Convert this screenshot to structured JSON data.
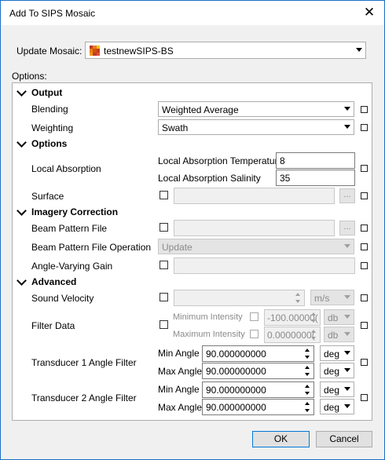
{
  "window": {
    "title": "Add To SIPS Mosaic",
    "close_glyph": "✕"
  },
  "update_mosaic": {
    "label": "Update Mosaic:",
    "value": "testnewSIPS-BS",
    "icon": "mosaic-icon"
  },
  "options_label": "Options:",
  "output": {
    "header": "Output",
    "blending": {
      "label": "Blending",
      "value": "Weighted Average"
    },
    "weighting": {
      "label": "Weighting",
      "value": "Swath"
    }
  },
  "options": {
    "header": "Options",
    "local_absorption": {
      "label": "Local Absorption",
      "temperature_label": "Local Absorption Temperature",
      "temperature_value": "8",
      "salinity_label": "Local Absorption Salinity",
      "salinity_value": "35"
    },
    "surface": {
      "label": "Surface",
      "browse": "..."
    }
  },
  "imagery": {
    "header": "Imagery Correction",
    "beam_pattern_file": {
      "label": "Beam Pattern File",
      "browse": "..."
    },
    "beam_pattern_file_operation": {
      "label": "Beam Pattern File Operation",
      "value": "Update"
    },
    "angle_varying_gain": {
      "label": "Angle-Varying Gain"
    }
  },
  "advanced": {
    "header": "Advanced",
    "sound_velocity": {
      "label": "Sound Velocity",
      "unit": "m/s"
    },
    "filter_data": {
      "label": "Filter Data",
      "min_intensity_label": "Minimum Intensity",
      "min_intensity_value": "-100.00000(",
      "min_intensity_unit": "db",
      "max_intensity_label": "Maximum Intensity",
      "max_intensity_value": "0.0000000(",
      "max_intensity_unit": "db"
    },
    "transducer1": {
      "label": "Transducer 1 Angle Filter",
      "min_label": "Min Angle",
      "min_value": "90.000000000",
      "min_unit": "deg",
      "max_label": "Max Angle",
      "max_value": "90.000000000",
      "max_unit": "deg"
    },
    "transducer2": {
      "label": "Transducer 2 Angle Filter",
      "min_label": "Min Angle",
      "min_value": "90.000000000",
      "min_unit": "deg",
      "max_label": "Max Angle",
      "max_value": "90.000000000",
      "max_unit": "deg"
    }
  },
  "buttons": {
    "ok": "OK",
    "cancel": "Cancel"
  },
  "colors": {
    "accent": "#0078d7",
    "window_border": "#1c6fc7",
    "dialog_bg": "#f0f0f0"
  }
}
